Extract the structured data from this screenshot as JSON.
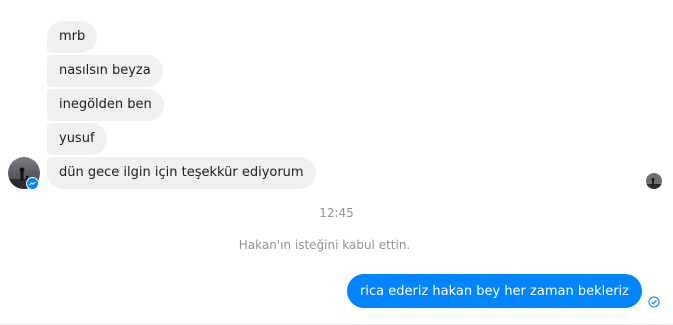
{
  "conversation": {
    "incoming_messages": [
      {
        "text": "mrb"
      },
      {
        "text": "nasılsın beyza"
      },
      {
        "text": "inegölden ben"
      },
      {
        "text": "yusuf"
      },
      {
        "text": "dün gece ilgin için teşekkür ediyorum"
      }
    ],
    "timestamp": "12:45",
    "system_message": "Hakan'ın isteğini kabul ettin.",
    "outgoing_message": {
      "text": "rica ederiz hakan bey her zaman bekleriz"
    }
  },
  "icons": {
    "sender_avatar": "user-avatar",
    "messenger_badge": "messenger-icon",
    "read_receipt_avatar": "read-receipt-avatar",
    "sent_status": "sent-check-icon"
  },
  "colors": {
    "incoming_bubble": "#f1f0f0",
    "outgoing_bubble": "#0084ff",
    "meta_text": "#90949c"
  }
}
